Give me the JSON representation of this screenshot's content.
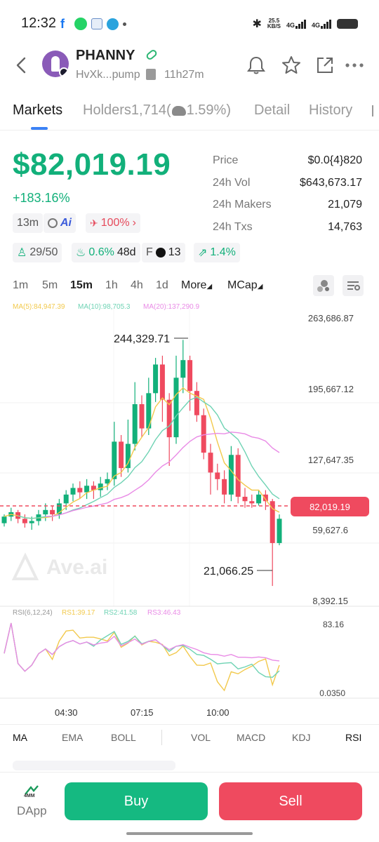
{
  "status_bar": {
    "time": "12:32",
    "net_speed_value": "25.5",
    "net_speed_unit": "KB/S",
    "sig1": "4G",
    "sig2": "4G",
    "icons": [
      "facebook-icon",
      "whatsapp-icon",
      "sms-app-icon",
      "telegram-icon",
      "more-dot-icon",
      "bluetooth-icon",
      "battery-icon"
    ]
  },
  "header": {
    "token_name": "PHANNY",
    "address": "HvXk...pump",
    "age": "11h27m",
    "icons": [
      "back-icon",
      "bell-icon",
      "star-icon",
      "share-icon",
      "more-icon"
    ]
  },
  "tabs": [
    {
      "label": "Markets",
      "active": true
    },
    {
      "label": "Holders1,714(",
      "active": false
    },
    {
      "label": "1.59%)",
      "active": false
    },
    {
      "label": "Detail",
      "active": false
    },
    {
      "label": "History",
      "active": false
    }
  ],
  "price": {
    "main": "$82,019.19",
    "change": "+183.16%",
    "chip_age": "13m",
    "chip_ai": "Ai",
    "chip_pct": "100%",
    "row2_a": "29/50",
    "row2_b": "0.6%",
    "row2_b2": "48d",
    "row2_c_prefix": "F",
    "row2_c": "13",
    "row2_d": "1.4%"
  },
  "stats": [
    {
      "label": "Price",
      "value": "$0.0{4}820"
    },
    {
      "label": "24h Vol",
      "value": "$643,673.17"
    },
    {
      "label": "24h Makers",
      "value": "21,079"
    },
    {
      "label": "24h Txs",
      "value": "14,763"
    }
  ],
  "timeframes": [
    {
      "label": "1m",
      "active": false
    },
    {
      "label": "5m",
      "active": false
    },
    {
      "label": "15m",
      "active": true
    },
    {
      "label": "1h",
      "active": false
    },
    {
      "label": "4h",
      "active": false
    },
    {
      "label": "1d",
      "active": false
    },
    {
      "label": "More",
      "active": false
    },
    {
      "label": "MCap",
      "active": false
    }
  ],
  "legend": {
    "ma5": "MA(5):84,947.39",
    "ma10": "MA(10):98,705.3",
    "ma20": "MA(20):137,290.9",
    "rsi_title": "RSI(6,12,24)",
    "rs1": "RS1:39.17",
    "rs2": "RS2:41.58",
    "rs3": "RS3:46.43"
  },
  "colors": {
    "up": "#12b07a",
    "down": "#ef4a5f",
    "ma5": "#f2c94c",
    "ma10": "#6fd3b4",
    "ma20": "#e98be6",
    "rsi1": "#f2c94c",
    "rsi2": "#6fd3b4",
    "rsi3": "#e98be6"
  },
  "chart_data": {
    "type": "candlestick",
    "y_ticks": [
      "263,686.87",
      "195,667.12",
      "127,647.35",
      "59,627.6",
      "8,392.15"
    ],
    "current_price_label": "82,019.19",
    "high_label": "244,329.71",
    "low_label": "21,066.25",
    "watermark": "Ave.ai",
    "x_ticks": [
      "04:30",
      "07:15",
      "10:00"
    ],
    "rsi_ticks": [
      "83.16",
      "0.0350"
    ],
    "candles": [
      [
        78000,
        84000,
        75000,
        86000
      ],
      [
        84000,
        88000,
        80000,
        92000
      ],
      [
        88000,
        82000,
        78000,
        90000
      ],
      [
        82000,
        78000,
        74000,
        86000
      ],
      [
        78000,
        80000,
        72000,
        84000
      ],
      [
        80000,
        86000,
        76000,
        90000
      ],
      [
        86000,
        90000,
        80000,
        96000
      ],
      [
        90000,
        86000,
        80000,
        94000
      ],
      [
        86000,
        96000,
        82000,
        100000
      ],
      [
        96000,
        104000,
        90000,
        108000
      ],
      [
        104000,
        110000,
        98000,
        114000
      ],
      [
        110000,
        106000,
        100000,
        116000
      ],
      [
        106000,
        112000,
        100000,
        118000
      ],
      [
        112000,
        108000,
        100000,
        116000
      ],
      [
        108000,
        114000,
        102000,
        120000
      ],
      [
        114000,
        118000,
        108000,
        124000
      ],
      [
        118000,
        152000,
        112000,
        170000
      ],
      [
        152000,
        128000,
        120000,
        158000
      ],
      [
        128000,
        150000,
        124000,
        172000
      ],
      [
        150000,
        186000,
        144000,
        206000
      ],
      [
        186000,
        164000,
        156000,
        194000
      ],
      [
        164000,
        196000,
        158000,
        210000
      ],
      [
        196000,
        222000,
        188000,
        228000
      ],
      [
        222000,
        190000,
        170000,
        230000
      ],
      [
        190000,
        156000,
        130000,
        196000
      ],
      [
        156000,
        210000,
        150000,
        230000
      ],
      [
        210000,
        226000,
        196000,
        244330
      ],
      [
        226000,
        198000,
        180000,
        230000
      ],
      [
        198000,
        176000,
        170000,
        206000
      ],
      [
        176000,
        142000,
        136000,
        182000
      ],
      [
        142000,
        124000,
        104000,
        150000
      ],
      [
        124000,
        118000,
        108000,
        132000
      ],
      [
        118000,
        104000,
        96000,
        126000
      ],
      [
        104000,
        140000,
        98000,
        148000
      ],
      [
        140000,
        102000,
        96000,
        146000
      ],
      [
        102000,
        98000,
        92000,
        110000
      ],
      [
        98000,
        96000,
        92000,
        104000
      ],
      [
        96000,
        104000,
        94000,
        108000
      ],
      [
        104000,
        98000,
        90000,
        108000
      ],
      [
        98000,
        60000,
        21066,
        100000
      ],
      [
        60000,
        82019,
        58000,
        86000
      ]
    ]
  },
  "indicators": [
    {
      "label": "MA",
      "active": true
    },
    {
      "label": "EMA",
      "active": false
    },
    {
      "label": "BOLL",
      "active": false
    },
    {
      "label": "VOL",
      "active": false
    },
    {
      "label": "MACD",
      "active": false
    },
    {
      "label": "KDJ",
      "active": false
    },
    {
      "label": "RSI",
      "active": true
    }
  ],
  "bottom": {
    "dapp_label": "DApp",
    "dapp_badge": "4MM",
    "buy_label": "Buy",
    "sell_label": "Sell"
  }
}
